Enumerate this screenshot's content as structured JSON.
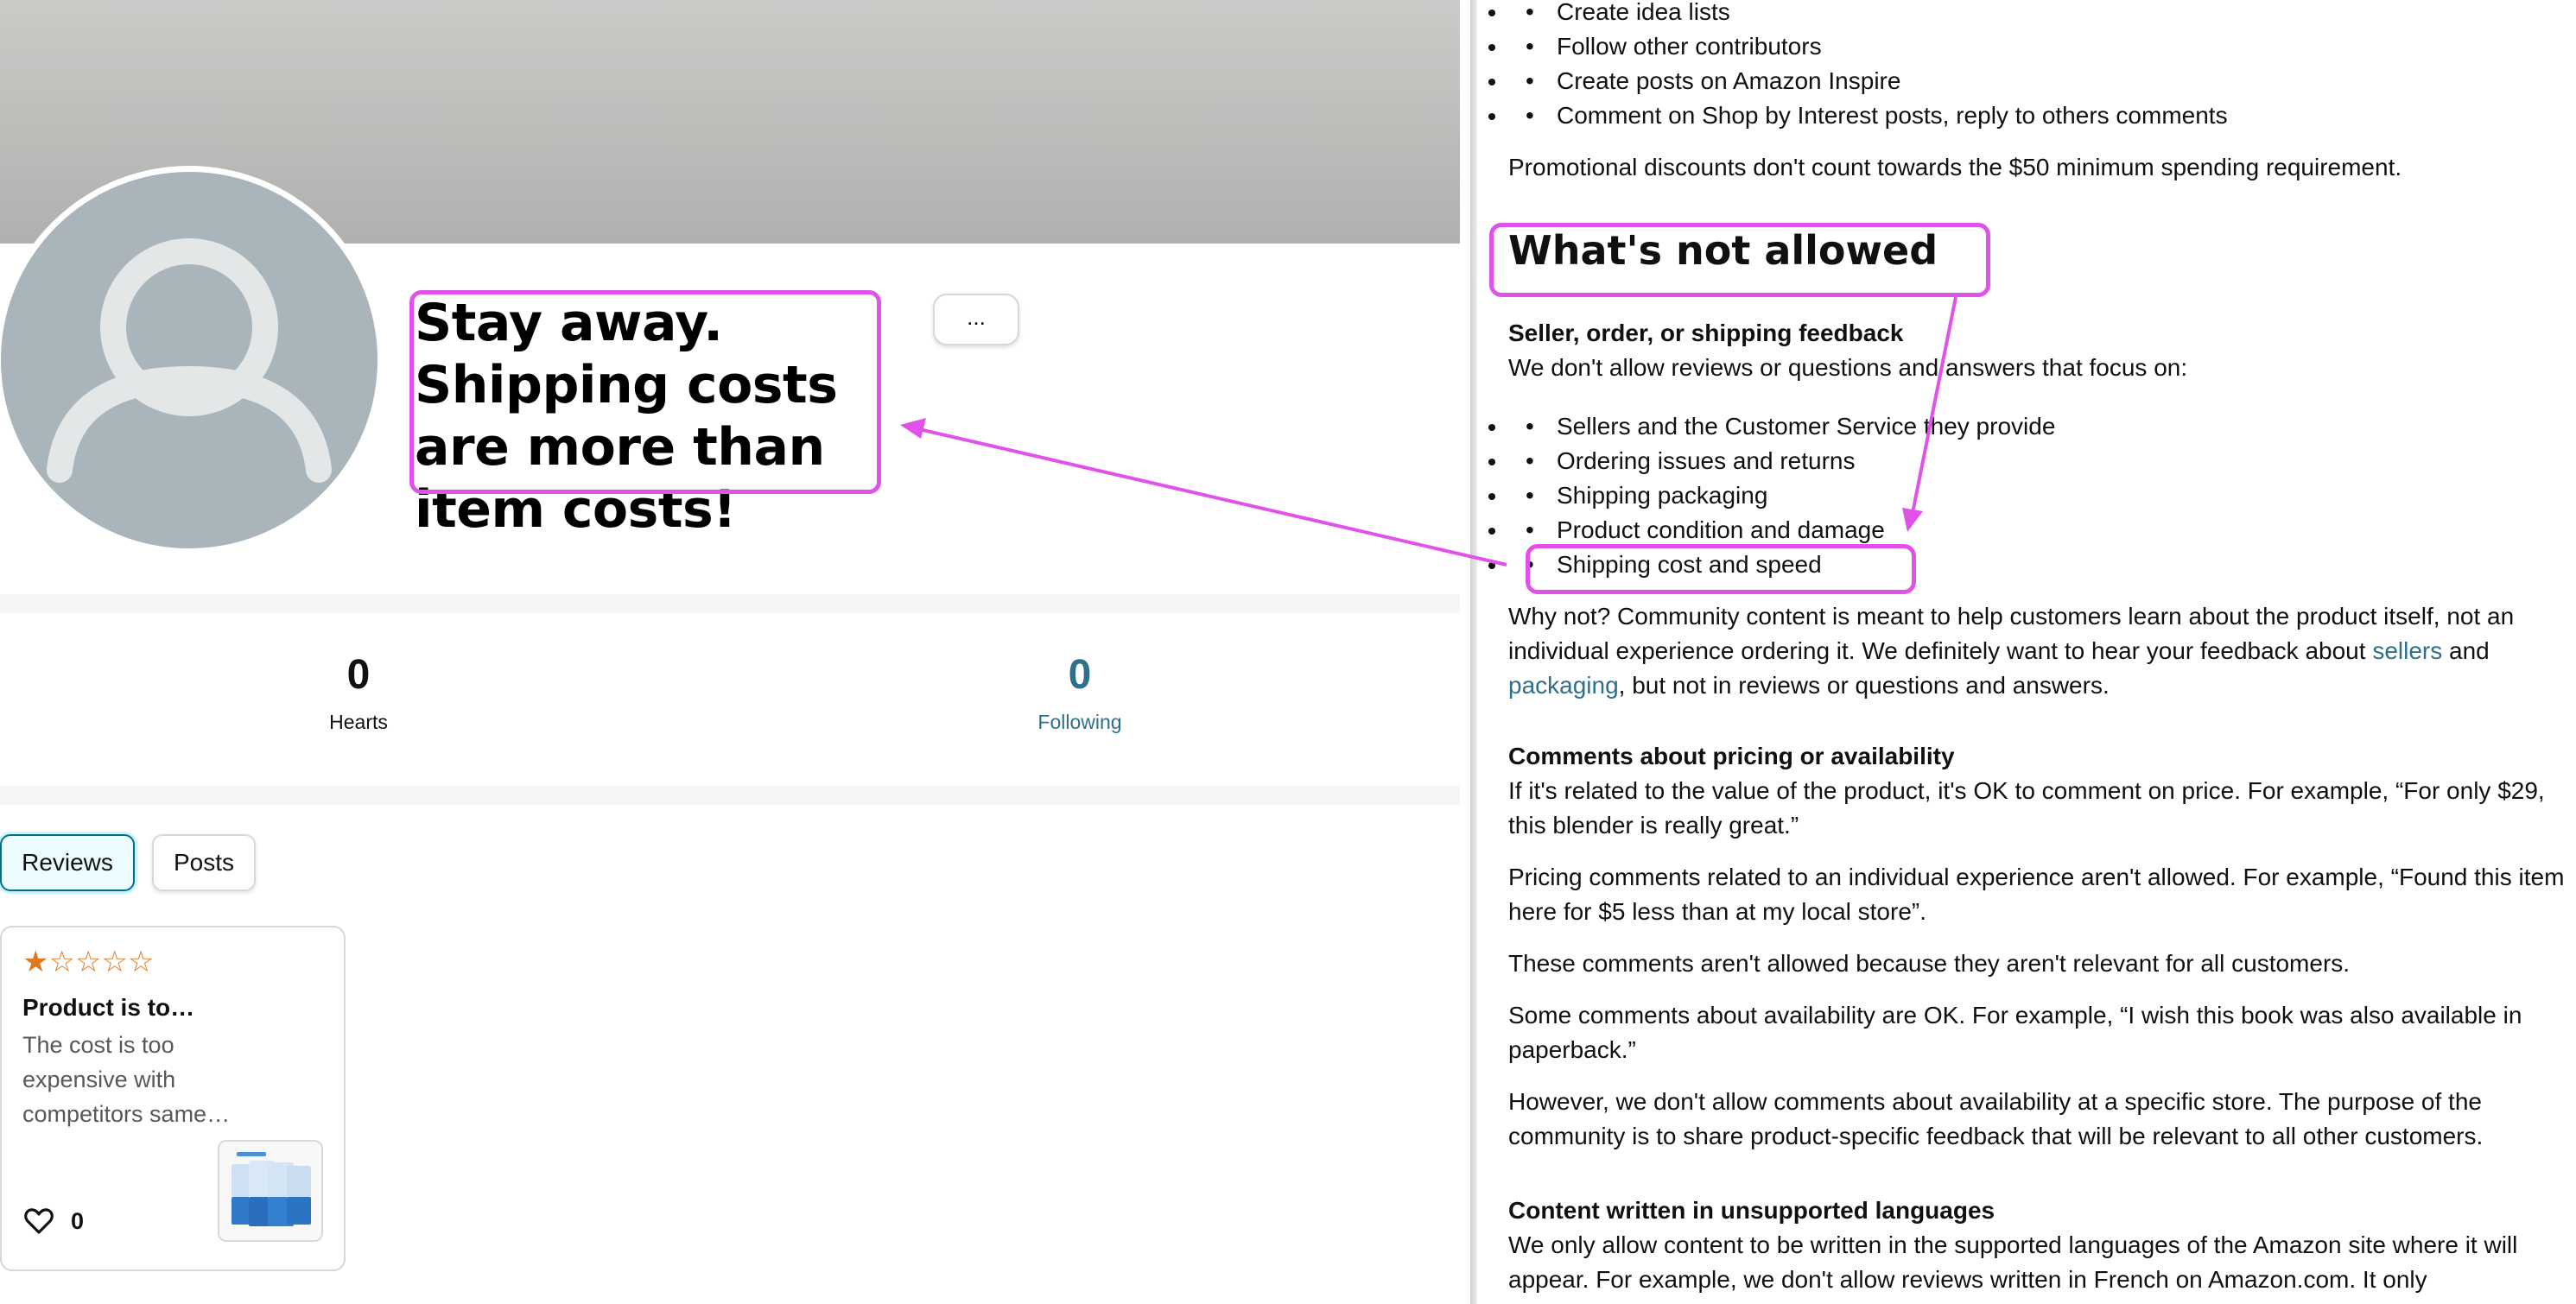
{
  "profile": {
    "name": "Stay away. Shipping costs are more than item costs!",
    "more_button": "...",
    "stats": [
      {
        "value": "0",
        "label": "Hearts"
      },
      {
        "value": "0",
        "label": "Following"
      }
    ],
    "tabs": [
      {
        "label": "Reviews",
        "active": true
      },
      {
        "label": "Posts",
        "active": false
      }
    ],
    "review": {
      "rating": 1,
      "rating_max": 5,
      "stars_filled": "★",
      "stars_empty": "☆☆☆☆",
      "title": "Product is to…",
      "text": "The cost is too expensive with competitors same…",
      "likes": "0"
    }
  },
  "guidelines": {
    "allowed_items": [
      "Create idea lists",
      "Follow other contributors",
      "Create posts on Amazon Inspire",
      "Comment on Shop by Interest posts, reply to others comments"
    ],
    "promo_note": "Promotional discounts don't count towards the $50 minimum spending requirement.",
    "heading": "What's not allowed",
    "seller_heading": "Seller, order, or shipping feedback",
    "seller_intro": "We don't allow reviews or questions and answers that focus on:",
    "not_allowed_items": [
      "Sellers and the Customer Service they provide",
      "Ordering issues and returns",
      "Shipping packaging",
      "Product condition and damage",
      "Shipping cost and speed"
    ],
    "why_not_1": "Why not? Community content is meant to help customers learn about the product itself, not an individual experience ordering it. We definitely want to hear your feedback about ",
    "link_sellers": "sellers",
    "why_and": "and ",
    "link_packaging": "packaging",
    "why_not_2": ", but not in reviews or questions and answers.",
    "pricing_heading": "Comments about pricing or availability",
    "pricing_p1": "If it's related to the value of the product, it's OK to comment on price. For example, “For only $29, this blender is really great.”",
    "pricing_p2": "Pricing comments related to an individual experience aren't allowed. For example, “Found this item here for $5 less than at my local store”.",
    "pricing_p3": "These comments aren't allowed because they aren't relevant for all customers.",
    "pricing_p4": "Some comments about availability are OK. For example, “I wish this book was also available in paperback.”",
    "pricing_p5": "However, we don't allow comments about availability at a specific store. The purpose of the community is to share product-specific feedback that will be relevant to all other customers.",
    "lang_heading": "Content written in unsupported languages",
    "lang_p1": "We only allow content to be written in the supported languages of the Amazon site where it will appear. For example, we don't allow reviews written in French on Amazon.com. It only"
  },
  "annotation_color": "#e052ea",
  "icons": [
    "avatar-placeholder-icon",
    "heart-icon",
    "ellipsis-icon",
    "star-icon"
  ]
}
